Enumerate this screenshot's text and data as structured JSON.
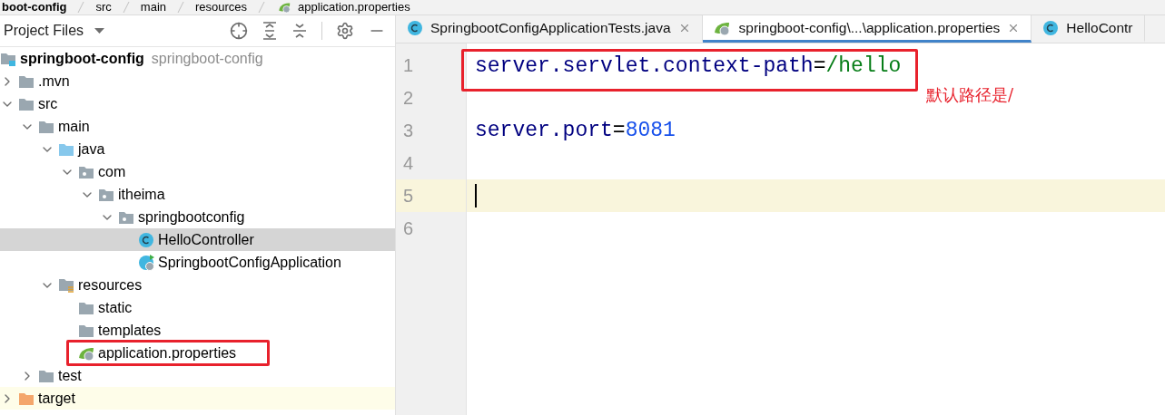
{
  "breadcrumb": [
    {
      "label": "boot-config",
      "kind": "module"
    },
    {
      "label": "src",
      "kind": "folder"
    },
    {
      "label": "main",
      "kind": "folder"
    },
    {
      "label": "resources",
      "kind": "folder"
    },
    {
      "label": "application.properties",
      "kind": "spring-properties"
    }
  ],
  "project_panel": {
    "title": "Project Files",
    "tree": [
      {
        "label": "springboot-config",
        "hint": "springboot-config",
        "kind": "module",
        "selected": false,
        "children": [
          {
            "label": ".mvn",
            "kind": "folder",
            "expanded": false,
            "selected": false
          },
          {
            "label": "src",
            "kind": "folder",
            "expanded": true,
            "selected": false,
            "children": [
              {
                "label": "main",
                "kind": "folder",
                "expanded": true,
                "selected": false,
                "children": [
                  {
                    "label": "java",
                    "kind": "source-folder",
                    "expanded": true,
                    "selected": false,
                    "children": [
                      {
                        "label": "com",
                        "kind": "package",
                        "expanded": true,
                        "selected": false,
                        "children": [
                          {
                            "label": "itheima",
                            "kind": "package",
                            "expanded": true,
                            "selected": false,
                            "children": [
                              {
                                "label": "springbootconfig",
                                "kind": "package",
                                "expanded": true,
                                "selected": false,
                                "children": [
                                  {
                                    "label": "HelloController",
                                    "kind": "class",
                                    "selected": true
                                  },
                                  {
                                    "label": "SpringbootConfigApplication",
                                    "kind": "spring-class",
                                    "selected": false
                                  }
                                ]
                              }
                            ]
                          }
                        ]
                      }
                    ]
                  },
                  {
                    "label": "resources",
                    "kind": "resources-folder",
                    "expanded": true,
                    "selected": false,
                    "children": [
                      {
                        "label": "static",
                        "kind": "folder",
                        "selected": false
                      },
                      {
                        "label": "templates",
                        "kind": "folder",
                        "selected": false
                      },
                      {
                        "label": "application.properties",
                        "kind": "spring-properties",
                        "selected": false,
                        "framed": true
                      }
                    ]
                  }
                ]
              },
              {
                "label": "test",
                "kind": "folder",
                "expanded": false,
                "selected": false
              }
            ]
          },
          {
            "label": "target",
            "kind": "excluded-folder",
            "expanded": false,
            "selected": false
          }
        ]
      }
    ]
  },
  "editor": {
    "tabs": [
      {
        "label": "SpringbootConfigApplicationTests.java",
        "kind": "class",
        "selected": false,
        "closable": true
      },
      {
        "label": "springboot-config\\...\\application.properties",
        "kind": "spring-properties",
        "selected": true,
        "closable": true
      },
      {
        "label": "HelloContr",
        "kind": "class",
        "selected": false,
        "closable": false
      }
    ],
    "lines": [
      {
        "number": "1",
        "current": false,
        "framed": true,
        "tokens": [
          {
            "kind": "key",
            "text": "server.servlet.context-path"
          },
          {
            "kind": "sep",
            "text": "="
          },
          {
            "kind": "string",
            "text": "/hello"
          }
        ]
      },
      {
        "number": "2",
        "current": false
      },
      {
        "number": "3",
        "current": false,
        "tokens": [
          {
            "kind": "key",
            "text": "server.port"
          },
          {
            "kind": "sep",
            "text": "="
          },
          {
            "kind": "number",
            "text": "8081"
          }
        ]
      },
      {
        "number": "4",
        "current": false
      },
      {
        "number": "5",
        "current": true
      },
      {
        "number": "6",
        "current": false
      }
    ]
  },
  "annotation": {
    "note": "默认路径是/"
  }
}
